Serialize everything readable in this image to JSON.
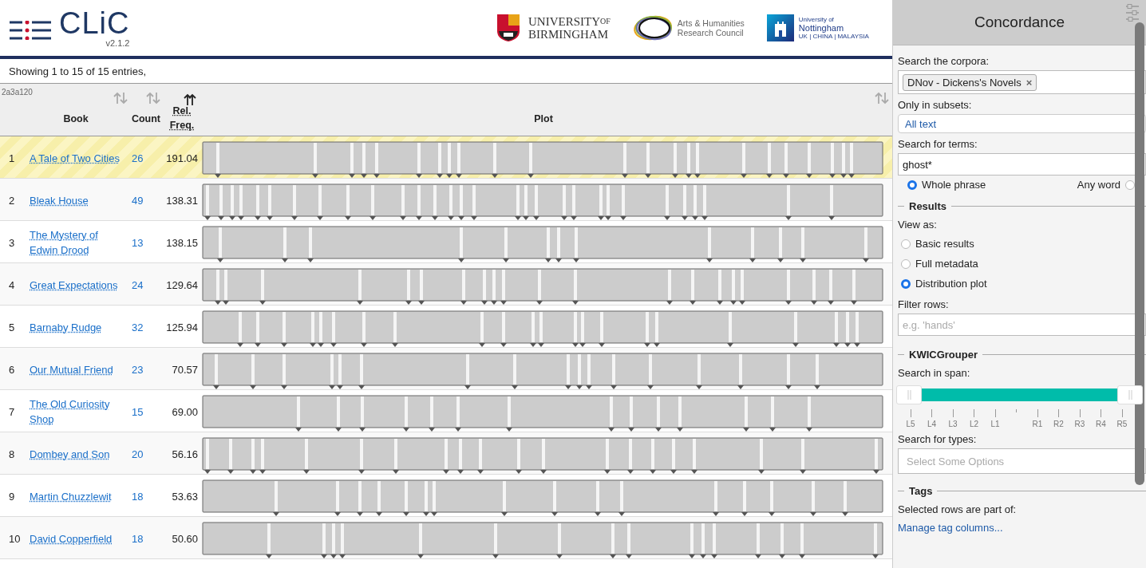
{
  "header": {
    "logo": {
      "name": "CLiC",
      "version": "v2.1.2"
    },
    "partners": [
      {
        "kind": "birmingham",
        "lines": [
          "UNIVERSITY",
          "BIRMINGHAM"
        ],
        "sup": "OF"
      },
      {
        "kind": "ahrc",
        "lines": [
          "Arts & Humanities",
          "Research Council"
        ]
      },
      {
        "kind": "nottingham",
        "lines": [
          "University of",
          "Nottingham",
          "UK | CHINA | MALAYSIA"
        ]
      }
    ]
  },
  "table": {
    "info": "Showing 1 to 15 of 15 entries,",
    "id_label": "2a3a120",
    "columns": [
      {
        "label": "Book",
        "sorted": false
      },
      {
        "label": "Count",
        "sorted": false
      },
      {
        "label": "Rel. Freq.",
        "sorted": true
      },
      {
        "label": "Plot",
        "sorted": false
      }
    ],
    "rows": [
      {
        "num": "1",
        "book": "A Tale of Two Cities",
        "count": "26",
        "rel_freq": "191.04",
        "selected": true
      },
      {
        "num": "2",
        "book": "Bleak House",
        "count": "49",
        "rel_freq": "138.31",
        "selected": false
      },
      {
        "num": "3",
        "book": "The Mystery of Edwin Drood",
        "count": "13",
        "rel_freq": "138.15",
        "selected": false
      },
      {
        "num": "4",
        "book": "Great Expectations",
        "count": "24",
        "rel_freq": "129.64",
        "selected": false
      },
      {
        "num": "5",
        "book": "Barnaby Rudge",
        "count": "32",
        "rel_freq": "125.94",
        "selected": false
      },
      {
        "num": "6",
        "book": "Our Mutual Friend",
        "count": "23",
        "rel_freq": "70.57",
        "selected": false
      },
      {
        "num": "7",
        "book": "The Old Curiosity Shop",
        "count": "15",
        "rel_freq": "69.00",
        "selected": false
      },
      {
        "num": "8",
        "book": "Dombey and Son",
        "count": "20",
        "rel_freq": "56.16",
        "selected": false
      },
      {
        "num": "9",
        "book": "Martin Chuzzlewit",
        "count": "18",
        "rel_freq": "53.63",
        "selected": false
      },
      {
        "num": "10",
        "book": "David Copperfield",
        "count": "18",
        "rel_freq": "50.60",
        "selected": false
      }
    ]
  },
  "sidebar": {
    "title": "Concordance",
    "corpora": {
      "label": "Search the corpora:",
      "tags": [
        {
          "label": "DNov - Dickens's Novels",
          "remove": "×"
        }
      ]
    },
    "subsets": {
      "label": "Only in subsets:",
      "value": "All text"
    },
    "terms": {
      "label": "Search for terms:",
      "value": "ghost*",
      "options": [
        {
          "label": "Whole phrase",
          "selected": true
        },
        {
          "label": "Any word",
          "selected": false
        }
      ]
    },
    "results": {
      "legend": "Results",
      "view_label": "View as:",
      "options": [
        {
          "label": "Basic results",
          "selected": false
        },
        {
          "label": "Full metadata",
          "selected": false
        },
        {
          "label": "Distribution plot",
          "selected": true
        }
      ],
      "filter_label": "Filter rows:",
      "filter_placeholder": "e.g. 'hands'"
    },
    "kwic": {
      "legend": "KWICGrouper",
      "span_label": "Search in span:",
      "handles": [
        {
          "level": 0
        },
        {
          "level": 1
        }
      ],
      "left_ticks": [
        "L5",
        "L4",
        "L3",
        "L2",
        "L1"
      ],
      "right_ticks": [
        "R1",
        "R2",
        "R3",
        "R4",
        "R5"
      ],
      "types_label": "Search for types:",
      "types_placeholder": "Select Some Options"
    },
    "tags": {
      "legend": "Tags",
      "text": "Selected rows are part of:",
      "link": "Manage tag columns..."
    }
  }
}
